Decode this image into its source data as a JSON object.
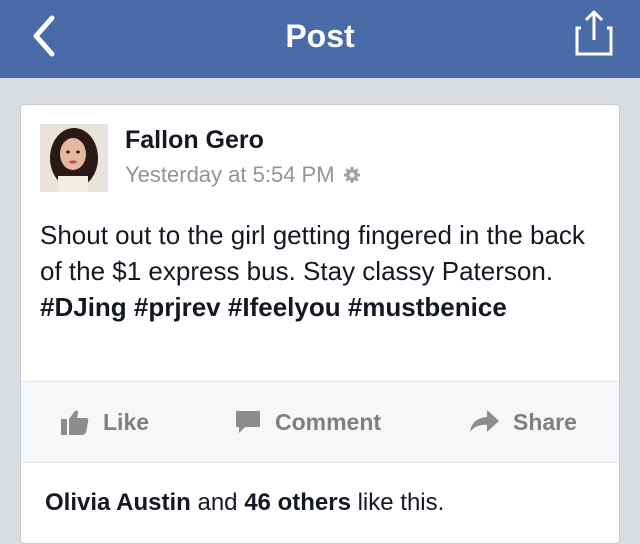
{
  "nav": {
    "title": "Post"
  },
  "post": {
    "author": "Fallon Gero",
    "timestamp": "Yesterday at 5:54 PM",
    "text_plain": "Shout out to the girl getting fingered in the back of the $1 express bus. Stay classy Paterson.",
    "hashtags": [
      "#DJing",
      "#prjrev",
      "#Ifeelyou",
      "#mustbenice"
    ]
  },
  "actions": {
    "like": "Like",
    "comment": "Comment",
    "share": "Share"
  },
  "likes": {
    "first_name": "Olivia Austin",
    "and": "and",
    "others": "46 others",
    "suffix": "like this."
  }
}
